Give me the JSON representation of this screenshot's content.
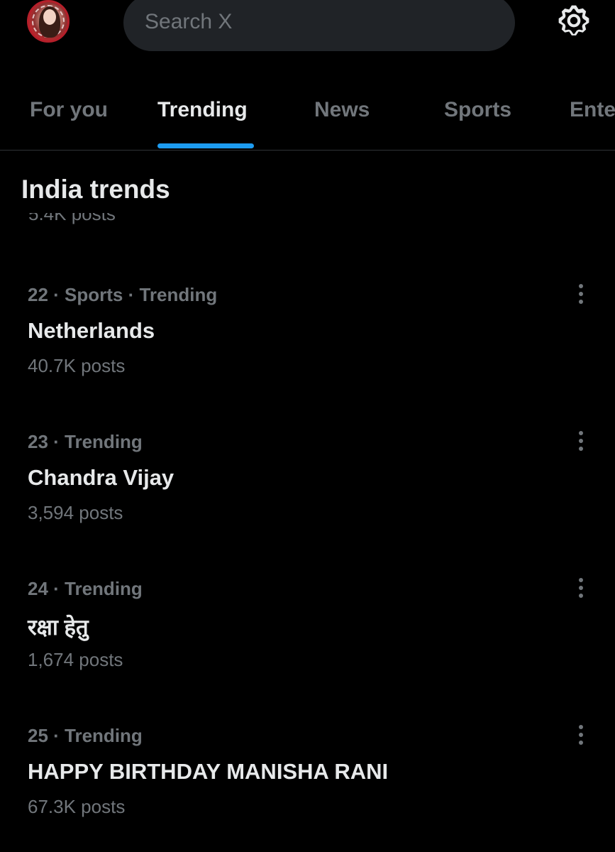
{
  "search": {
    "placeholder": "Search X"
  },
  "tabs": [
    {
      "label": "For you",
      "active": false
    },
    {
      "label": "Trending",
      "active": true
    },
    {
      "label": "News",
      "active": false
    },
    {
      "label": "Sports",
      "active": false
    },
    {
      "label": "Ente",
      "active": false
    }
  ],
  "section": {
    "title": "India trends",
    "clipped_text": "5.4K posts"
  },
  "trends": [
    {
      "meta": "22 · Sports · Trending",
      "name": "Netherlands",
      "posts": "40.7K posts"
    },
    {
      "meta": "23 · Trending",
      "name": "Chandra Vijay",
      "posts": "3,594 posts"
    },
    {
      "meta": "24 · Trending",
      "name": "रक्षा हेतु",
      "posts": "1,674 posts"
    },
    {
      "meta": "25 · Trending",
      "name": "HAPPY BIRTHDAY MANISHA RANI",
      "posts": "67.3K posts"
    }
  ],
  "icons": {
    "settings": "gear-icon",
    "more": "more-vertical-icon"
  },
  "colors": {
    "background": "#000000",
    "accent": "#1d9bf0",
    "text_primary": "#e7e9ea",
    "text_secondary": "#71767b",
    "search_bg": "#202327",
    "divider": "#2f3336"
  }
}
